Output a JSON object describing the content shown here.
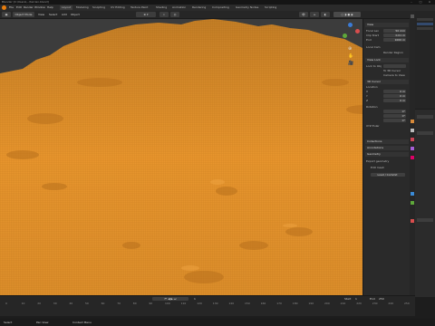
{
  "title_bar": {
    "text": "Blender [C:\\Users\\...\\terrain.blend]"
  },
  "menu": [
    "File",
    "Edit",
    "Render",
    "Window",
    "Help"
  ],
  "workspaces": [
    "Layout",
    "Modeling",
    "Sculpting",
    "UV Editing",
    "Texture Paint",
    "Shading",
    "Animation",
    "Rendering",
    "Compositing",
    "Geometry Nodes",
    "Scripting"
  ],
  "viewport_header": {
    "mode": "Object Mode",
    "view": "View",
    "select": "Select",
    "add": "Add",
    "object": "Object"
  },
  "npanel": {
    "sections": {
      "view": "View",
      "focal_length_label": "Focal Len",
      "focal_length": "50 mm",
      "clip_start_label": "Clip Start",
      "clip_start": "0.01 m",
      "clip_end_label": "End",
      "clip_end": "1000 m",
      "local_camera_label": "Local Cam",
      "render_region_label": "Render Region",
      "view_lock": "View Lock",
      "lock_to_object_label": "Lock to Obj",
      "lock_to_3d_cursor": "To 3D Cursor",
      "lock_camera": "Camera to View",
      "cursor": "3D Cursor",
      "location": "Location",
      "x": "X",
      "y": "Y",
      "z": "Z",
      "loc_x": "0 m",
      "loc_y": "0 m",
      "loc_z": "0 m",
      "rotation": "Rotation",
      "rot_x": "0°",
      "rot_y": "0°",
      "rot_z": "0°",
      "rotation_mode": "XYZ Euler",
      "collections": "Collections",
      "annotations": "Annotations",
      "geometry": "Geometry",
      "geo_label": "Export geometry",
      "edit_label": "Edit mesh",
      "add_button": "Load / Commit"
    }
  },
  "timeline": {
    "ticks": [
      "0",
      "10",
      "20",
      "30",
      "40",
      "50",
      "60",
      "70",
      "80",
      "90",
      "100",
      "110",
      "120",
      "130",
      "140",
      "150",
      "160",
      "170",
      "180",
      "190",
      "200",
      "210",
      "220",
      "230",
      "240",
      "250"
    ],
    "current_frame": "1",
    "start_label": "Start",
    "start": "1",
    "end_label": "End",
    "end": "250"
  },
  "status": {
    "left": "Select",
    "mid": "Pan View",
    "right": "Context Menu"
  },
  "colors": {
    "terrain": "#e8962e",
    "background": "#3b3b3b",
    "accent": "#3b6fb3"
  }
}
